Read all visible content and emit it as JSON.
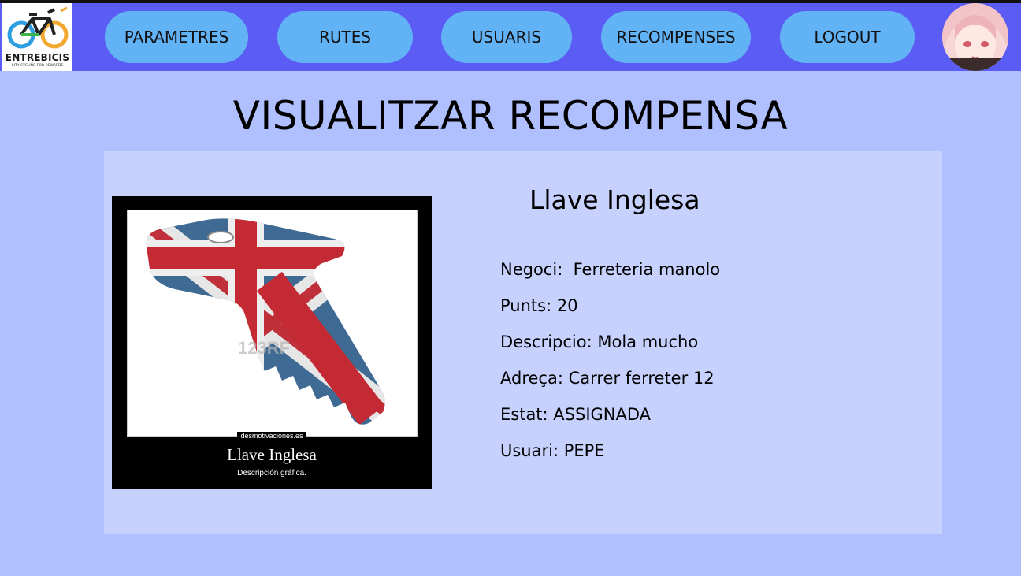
{
  "brand": {
    "name": "ENTREBICIS",
    "tagline": "CITY CYCLING FOR REWARDS",
    "colors": {
      "nav_bg": "#5b5cf4",
      "button_bg": "#62b3f6",
      "page_bg": "#b0bffe",
      "card_bg": "#c6d1fd"
    }
  },
  "nav": {
    "parametres": "PARAMETRES",
    "rutes": "RUTES",
    "usuaris": "USUARIS",
    "recompenses": "RECOMPENSES",
    "logout": "LOGOUT"
  },
  "page": {
    "title": "VISUALITZAR RECOMPENSA"
  },
  "reward": {
    "name": "Llave Inglesa",
    "image": {
      "watermark": "123RF",
      "site": "desmotivaciones.es",
      "caption_title": "Llave Inglesa",
      "caption_sub": "Descripción gráfica."
    },
    "details": {
      "negoci": "Negoci:  Ferreteria manolo",
      "punts": "Punts: 20",
      "descripcio": "Descripcio: Mola mucho",
      "adreca": "Adreça: Carrer ferreter 12",
      "estat": "Estat: ASSIGNADA",
      "usuari": "Usuari: PEPE"
    }
  }
}
